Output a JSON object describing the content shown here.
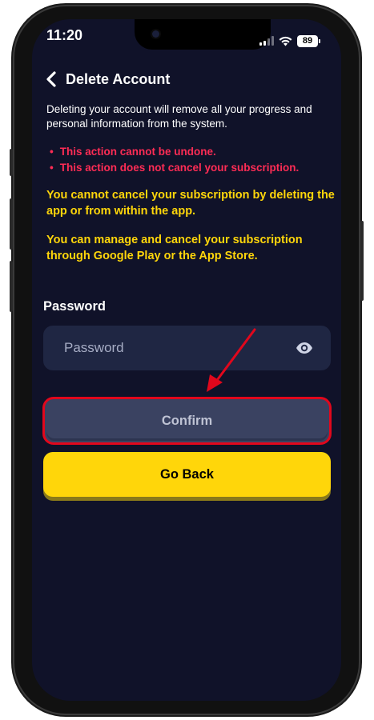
{
  "status_bar": {
    "time": "11:20",
    "battery": "89"
  },
  "header": {
    "title": "Delete Account"
  },
  "intro_text": "Deleting your account will remove all your progress and personal information from the system.",
  "warnings": [
    "This action cannot be undone.",
    "This action does not cancel your subscription."
  ],
  "notices": [
    "You cannot cancel your subscription by deleting the app or from within the app.",
    "You can manage and cancel your subscription through Google Play or the App Store."
  ],
  "password": {
    "label": "Password",
    "placeholder": "Password",
    "value": ""
  },
  "buttons": {
    "confirm": "Confirm",
    "go_back": "Go Back"
  },
  "icons": {
    "back": "chevron-left-icon",
    "visibility": "eye-icon",
    "wifi": "wifi-icon",
    "signal": "signal-icon",
    "battery": "battery-icon"
  },
  "colors": {
    "background": "#101229",
    "warning_red": "#ff2c55",
    "notice_yellow": "#ffd60a",
    "input_bg": "#1f2643",
    "confirm_bg": "#3a4261",
    "highlight_red": "#e1071c",
    "go_back_bg": "#ffd60a"
  }
}
